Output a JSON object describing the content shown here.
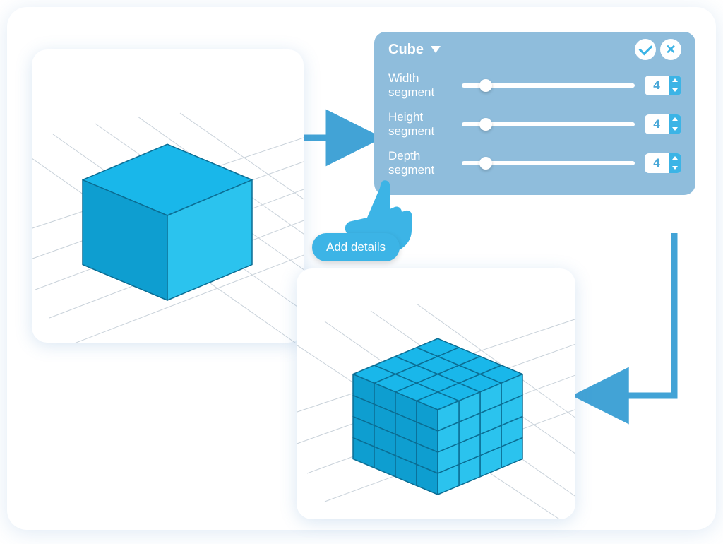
{
  "panel": {
    "title": "Cube",
    "params": [
      {
        "label": "Width segment",
        "value": 4,
        "thumb_pct": 10
      },
      {
        "label": "Height segment",
        "value": 4,
        "thumb_pct": 10
      },
      {
        "label": "Depth segment",
        "value": 4,
        "thumb_pct": 10
      }
    ]
  },
  "button": {
    "label": "Add details"
  },
  "cubes": {
    "before_segments": 1,
    "after_segments": 4
  },
  "colors": {
    "cube_top": "#19b7ea",
    "cube_left": "#0e9ed0",
    "cube_right": "#2bc3ee",
    "edge": "#0b6d93",
    "panel": "#8fbddc",
    "accent": "#3cb4e6",
    "arrow": "#42a3d6"
  }
}
